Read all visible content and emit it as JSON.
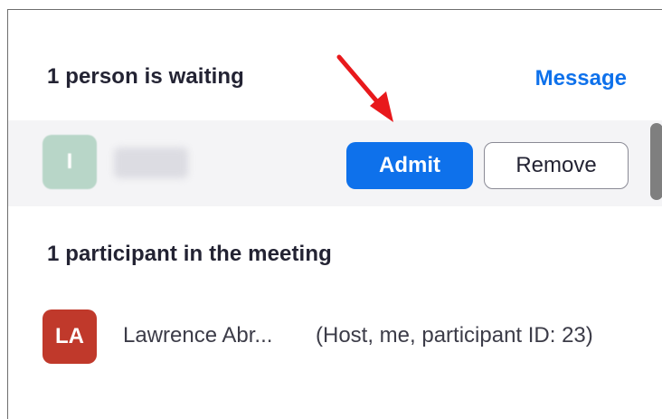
{
  "waiting_room": {
    "title": "1 person is waiting",
    "message_label": "Message",
    "person": {
      "avatar_initial": "I",
      "avatar_color": "#b8d6c8"
    },
    "admit_label": "Admit",
    "remove_label": "Remove"
  },
  "meeting": {
    "title": "1 participant in the meeting",
    "participants": [
      {
        "avatar_initials": "LA",
        "avatar_color": "#c0392b",
        "name": "Lawrence Abr...",
        "meta": "(Host, me, participant ID: 23)"
      }
    ]
  },
  "colors": {
    "accent": "#0e71eb",
    "annotation_arrow": "#e8191c",
    "waiting_row_bg": "#f4f4f6"
  },
  "icons": {
    "annotation": "red-arrow-pointing-at-admit"
  }
}
